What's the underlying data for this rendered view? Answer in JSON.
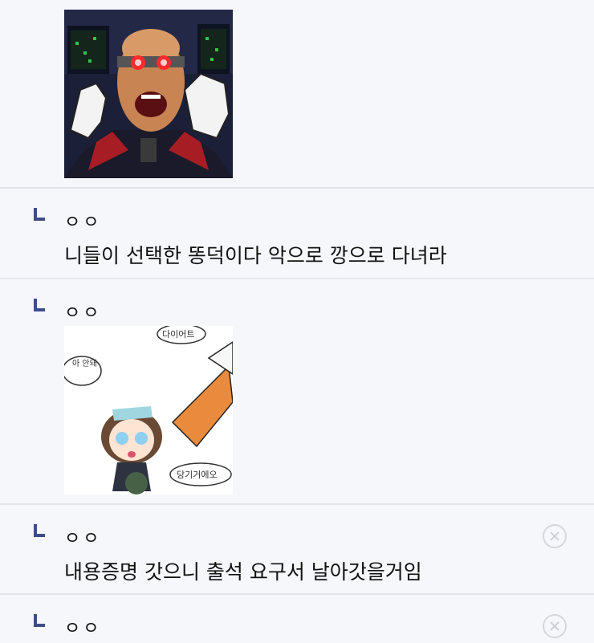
{
  "comments": [
    {
      "type": "image",
      "image_alt": "angry bald commander with red goggles pixel art"
    },
    {
      "type": "reply",
      "nickname": "ㅇㅇ",
      "text": "니들이 선택한 똥덕이다 악으로 깡으로 다녀라"
    },
    {
      "type": "reply-image",
      "nickname": "ㅇㅇ",
      "image_alt": "chibi girl crying held by a giant carrot",
      "sticker_texts": [
        "다이어트",
        "아 안돼",
        "당기거에오"
      ]
    },
    {
      "type": "reply",
      "nickname": "ㅇㅇ",
      "text": "내용증명 갓으니 출석 요구서 날아갓을거임"
    },
    {
      "type": "reply",
      "nickname": "ㅇㅇ",
      "text": ""
    }
  ],
  "colors": {
    "background": "#f6f7fb",
    "divider": "#e3e5ea",
    "reply_marker": "#3d4e86",
    "delete_icon": "#cdced3"
  },
  "icons": {
    "reply": "reply-arrow-icon",
    "delete": "close-circle-icon"
  }
}
